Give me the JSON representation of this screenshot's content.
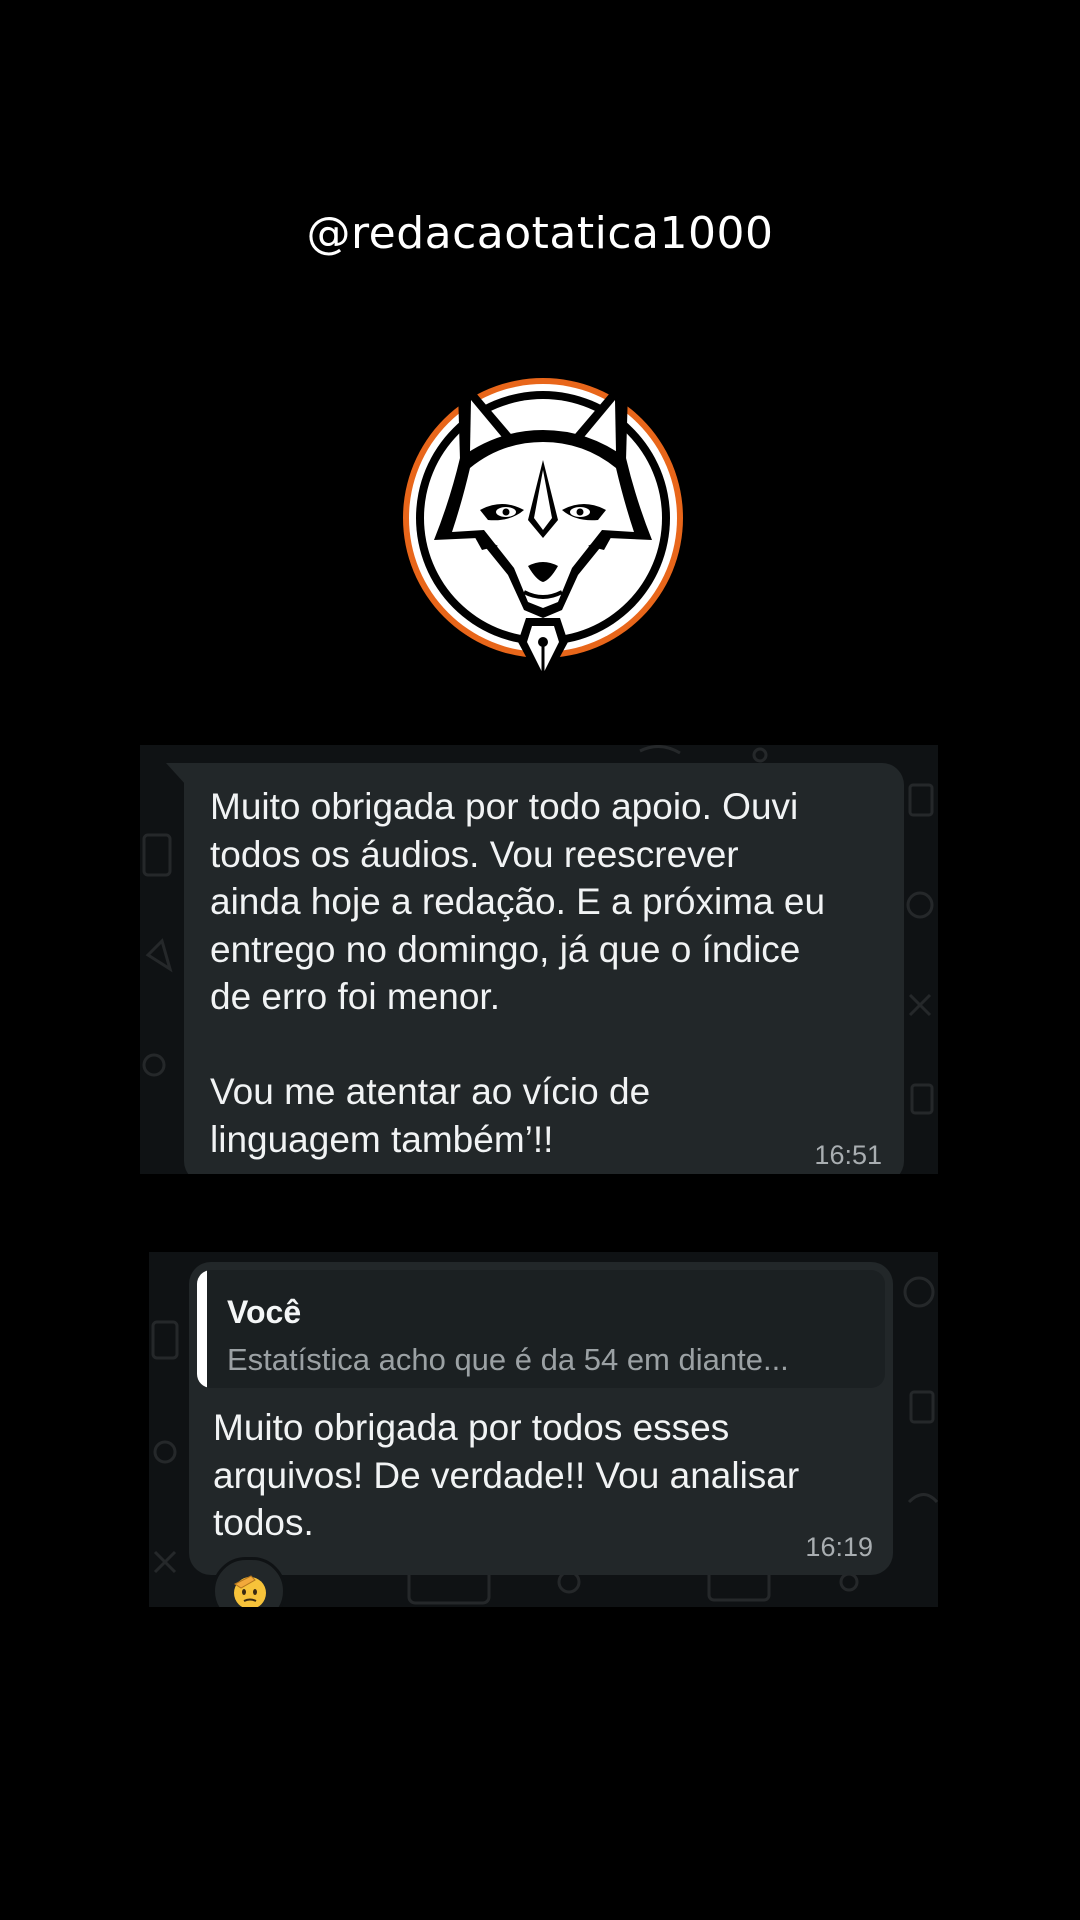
{
  "header": {
    "handle": "@redacaotatica1000"
  },
  "logo": {
    "icon": "fox-pen-logo-icon",
    "colors": {
      "ring": "#e8661a",
      "fill": "#ffffff",
      "ink": "#000000"
    }
  },
  "chat1": {
    "message": "Muito obrigada por todo apoio. Ouvi\ntodos os áudios. Vou reescrever\nainda hoje a redação. E a próxima eu\nentrego no domingo, já que o índice\nde erro foi menor.\n\nVou me atentar ao vício de\nlinguagem também’!!",
    "time": "16:51"
  },
  "chat2": {
    "quote_author": "Você",
    "quote_text": "Estatística acho que é da 54 em diante...",
    "message": "Muito obrigada por todos esses\narquivos! De verdade!! Vou analisar\ntodos.",
    "time": "16:19",
    "reaction_icon": "saluting-face-emoji-icon"
  },
  "colors": {
    "background": "#000000",
    "chat_wallpaper": "#0f1214",
    "bubble": "#222729",
    "quote_background": "#1b2022",
    "meta_text": "#a9aeb1"
  }
}
